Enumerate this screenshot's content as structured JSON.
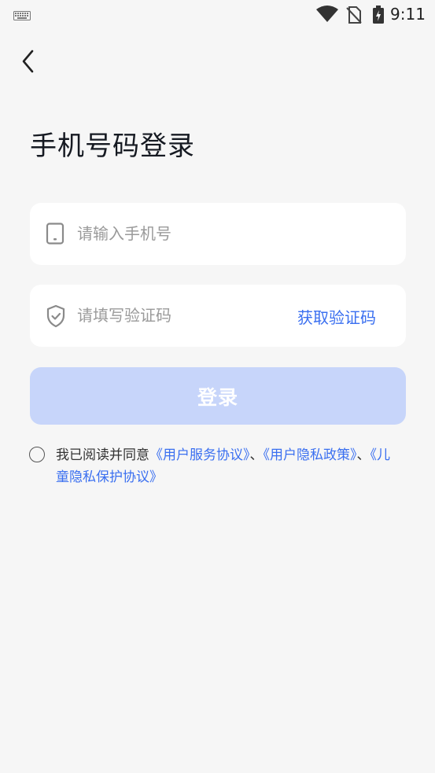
{
  "status_bar": {
    "time": "9:11",
    "icons": [
      "keyboard-icon",
      "wifi-icon",
      "no-sim-icon",
      "battery-charging-icon"
    ]
  },
  "nav": {
    "back_icon": "chevron-left-icon"
  },
  "title": "手机号码登录",
  "phone_field": {
    "icon": "phone-icon",
    "placeholder": "请输入手机号",
    "value": ""
  },
  "code_field": {
    "icon": "shield-check-icon",
    "placeholder": "请填写验证码",
    "value": "",
    "get_code_label": "获取验证码"
  },
  "login_button": {
    "label": "登录"
  },
  "agreement": {
    "checked": false,
    "prefix": "我已阅读并同意",
    "link1": "《用户服务协议》",
    "sep1": "、",
    "link2": "《用户隐私政策》",
    "sep2": "、",
    "link3": "《儿童隐私保护协议》"
  },
  "colors": {
    "accent": "#3a6ff0",
    "login_button_disabled": "#c7d5fa",
    "background": "#f6f6f6",
    "card": "#ffffff"
  }
}
